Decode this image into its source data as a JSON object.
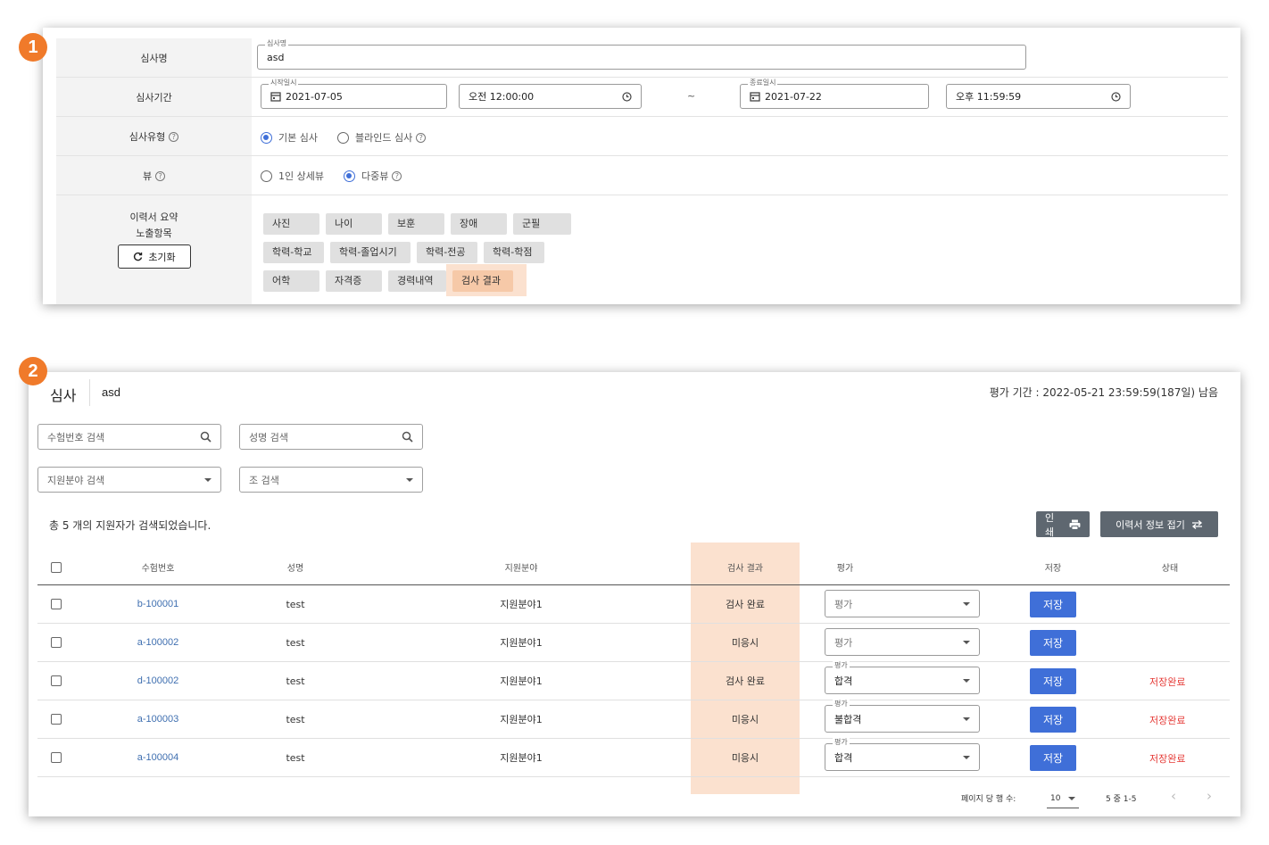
{
  "badges": {
    "one": "1",
    "two": "2"
  },
  "form": {
    "name_label": "심사명",
    "name_legend": "심사명",
    "name_value": "asd",
    "period_label": "심사기간",
    "start_date_legend": "시작일시",
    "start_date": "2021-07-05",
    "start_time": "오전 12:00:00",
    "range_sep": "~",
    "end_date_legend": "종료일시",
    "end_date": "2021-07-22",
    "end_time": "오후 11:59:59",
    "type_label": "심사유형",
    "type_options": [
      {
        "label": "기본 심사",
        "selected": true
      },
      {
        "label": "블라인드 심사",
        "selected": false
      }
    ],
    "view_label": "뷰",
    "view_options": [
      {
        "label": "1인 상세뷰",
        "selected": false
      },
      {
        "label": "다중뷰",
        "selected": true
      }
    ],
    "summary_label_1": "이력서 요약",
    "summary_label_2": "노출항목",
    "reset_label": "초기화",
    "chips": [
      "사진",
      "나이",
      "보훈",
      "장애",
      "군필",
      "학력-학교",
      "학력-졸업시기",
      "학력-전공",
      "학력-학점",
      "어학",
      "자격증",
      "경력내역",
      "검사 결과"
    ],
    "help_glyph": "?"
  },
  "review": {
    "title": "심사",
    "name": "asd",
    "period": "평가 기간 : 2022-05-21 23:59:59(187일) 남음",
    "search_number_placeholder": "수험번호 검색",
    "search_name_placeholder": "성명 검색",
    "field_filter_placeholder": "지원분야 검색",
    "group_filter_placeholder": "조 검색",
    "count_text": "총 5 개의 지원자가 검색되었습니다.",
    "print_label": "인쇄",
    "collapse_label": "이력서 정보 접기",
    "columns": [
      "수험번호",
      "성명",
      "지원분야",
      "검사 결과",
      "평가",
      "저장",
      "상태"
    ],
    "rows": [
      {
        "number": "b-100001",
        "name": "test",
        "field": "지원분야1",
        "result": "검사 완료",
        "eval_legend": "",
        "eval": "평가",
        "save": "저장",
        "status": ""
      },
      {
        "number": "a-100002",
        "name": "test",
        "field": "지원분야1",
        "result": "미응시",
        "eval_legend": "",
        "eval": "평가",
        "save": "저장",
        "status": ""
      },
      {
        "number": "d-100002",
        "name": "test",
        "field": "지원분야1",
        "result": "검사 완료",
        "eval_legend": "평가",
        "eval": "합격",
        "save": "저장",
        "status": "저장완료"
      },
      {
        "number": "a-100003",
        "name": "test",
        "field": "지원분야1",
        "result": "미응시",
        "eval_legend": "평가",
        "eval": "불합격",
        "save": "저장",
        "status": "저장완료"
      },
      {
        "number": "a-100004",
        "name": "test",
        "field": "지원분야1",
        "result": "미응시",
        "eval_legend": "평가",
        "eval": "합격",
        "save": "저장",
        "status": "저장완료"
      }
    ],
    "pagination": {
      "rows_label": "페이지 당 행 수:",
      "rows_value": "10",
      "range": "5 중 1-5",
      "prev": "‹",
      "next": "›"
    }
  },
  "colors": {
    "accent": "#3f6fd8",
    "badge": "#f07a2a",
    "highlight": "#fbe1cf",
    "saved": "#e53935",
    "dark_button": "#5e6770"
  }
}
